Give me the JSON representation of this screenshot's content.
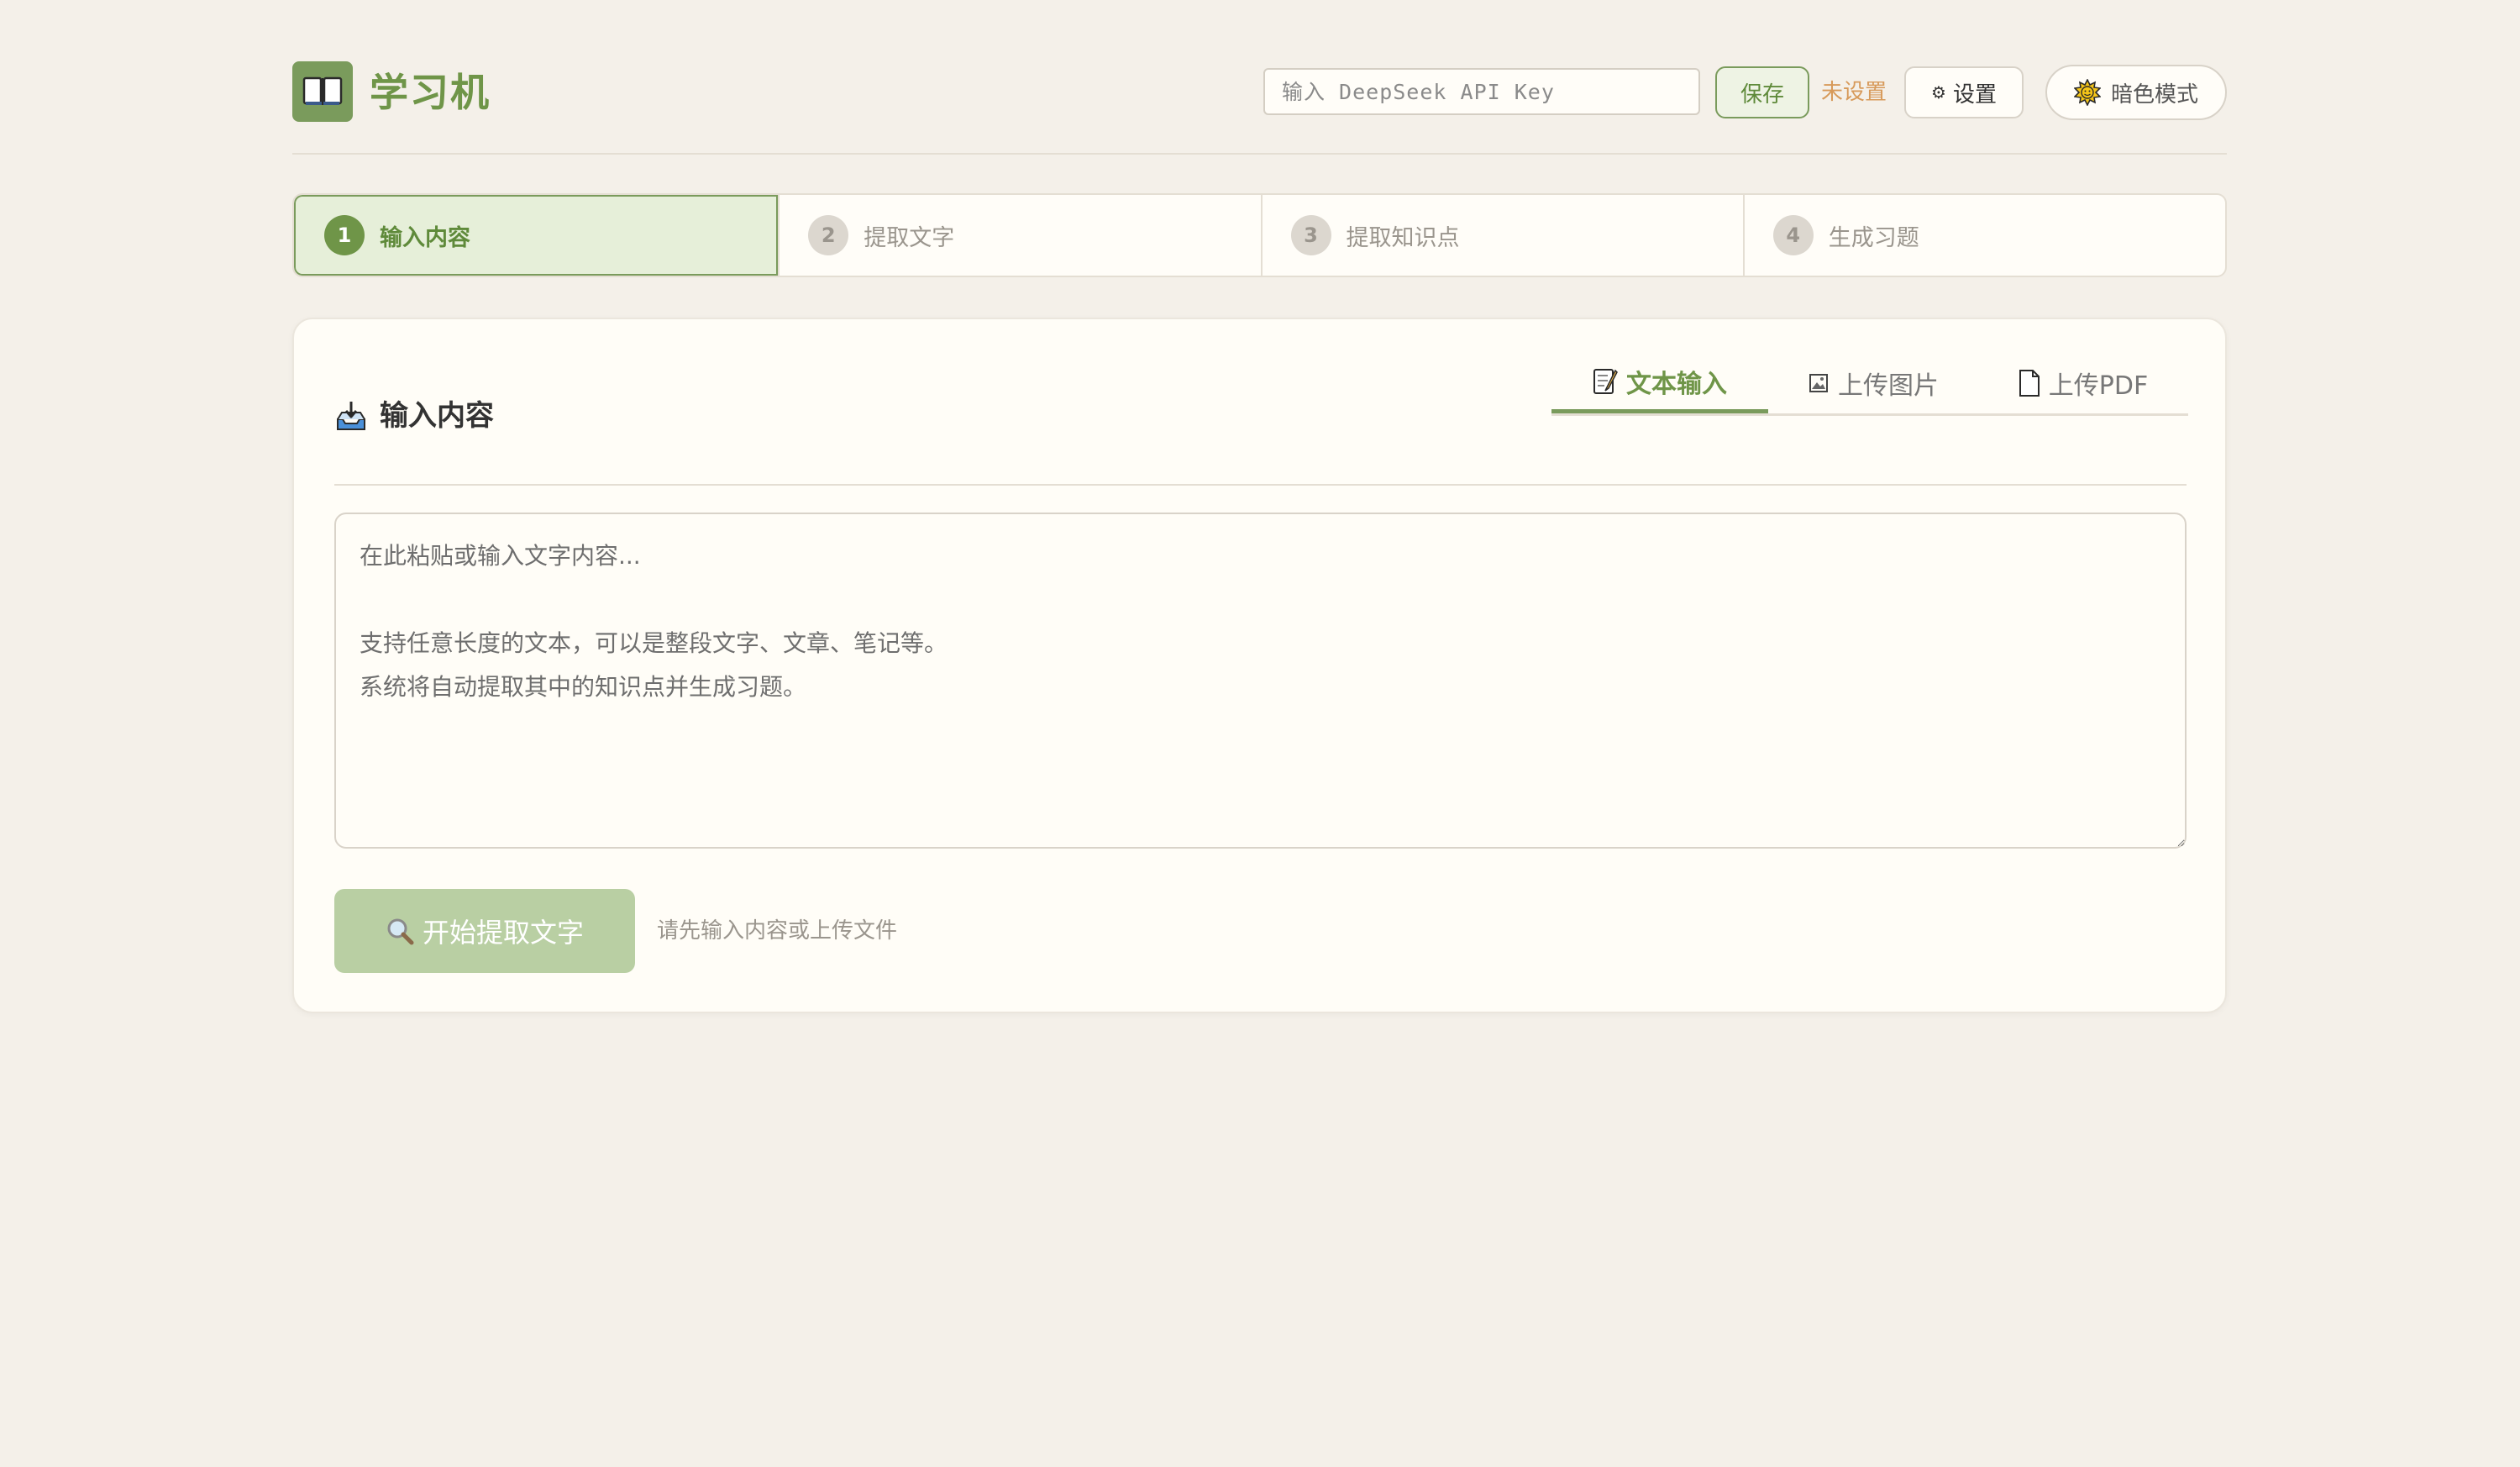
{
  "header": {
    "app_title": "学习机",
    "logo_icon": "open-book-icon",
    "api_key_placeholder": "输入 DeepSeek API Key",
    "save_label": "保存",
    "api_status": "未设置",
    "settings_label": "设置",
    "settings_icon": "gear-icon",
    "dark_mode_label": "暗色模式",
    "dark_mode_icon": "sun-icon"
  },
  "steps": [
    {
      "num": "1",
      "label": "输入内容",
      "active": true
    },
    {
      "num": "2",
      "label": "提取文字",
      "active": false
    },
    {
      "num": "3",
      "label": "提取知识点",
      "active": false
    },
    {
      "num": "4",
      "label": "生成习题",
      "active": false
    }
  ],
  "card": {
    "title": "输入内容",
    "title_icon": "inbox-tray-icon",
    "tabs": [
      {
        "label": "文本输入",
        "icon": "memo-icon",
        "active": true
      },
      {
        "label": "上传图片",
        "icon": "image-icon",
        "active": false
      },
      {
        "label": "上传PDF",
        "icon": "document-icon",
        "active": false
      }
    ],
    "textarea_placeholder": "在此粘贴或输入文字内容...\n\n支持任意长度的文本，可以是整段文字、文章、笔记等。\n系统将自动提取其中的知识点并生成习题。",
    "start_button_label": "开始提取文字",
    "start_button_icon": "magnifier-icon",
    "hint": "请先输入内容或上传文件"
  },
  "colors": {
    "accent": "#6f9548",
    "background": "#f4f0e9",
    "status_warning": "#d79a5a",
    "disabled_button": "#b9cfa3"
  }
}
